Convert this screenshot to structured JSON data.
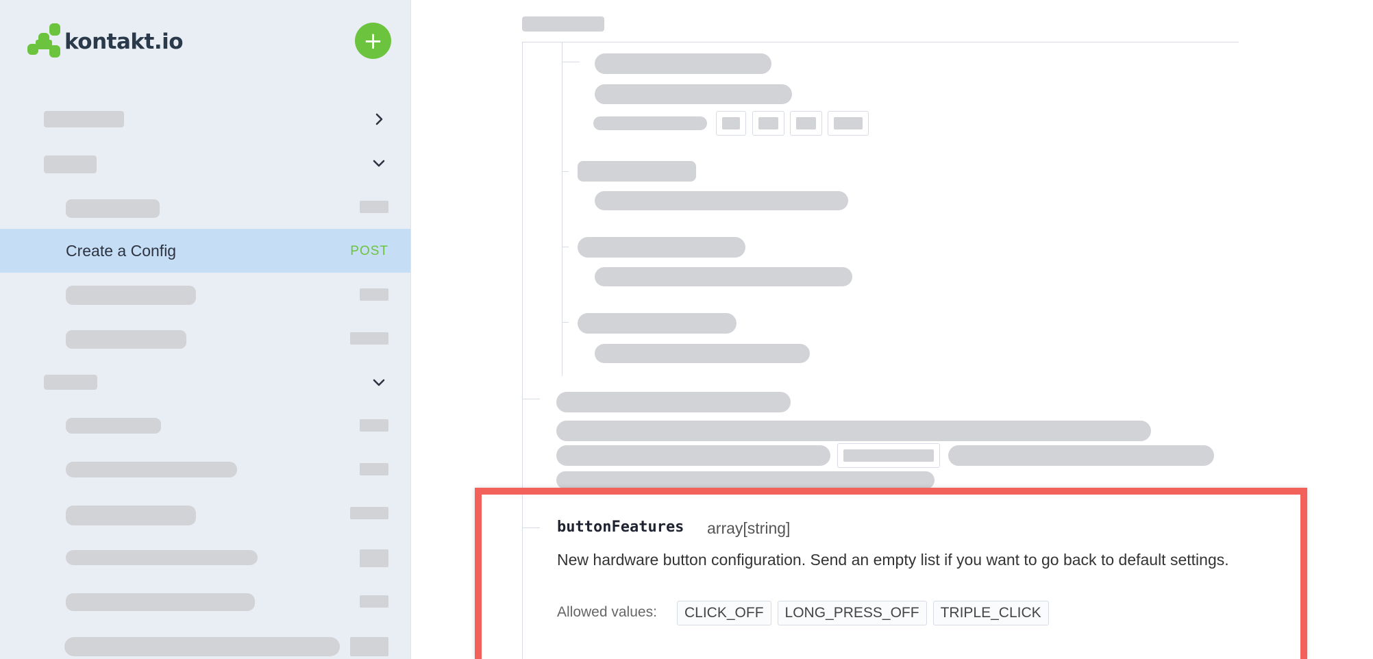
{
  "app": {
    "logo_text": "kontakt.io",
    "add_label": "+"
  },
  "sidebar": {
    "active_item": {
      "label": "Create a Config",
      "method": "POST"
    }
  },
  "field": {
    "name": "buttonFeatures",
    "type": "array[string]",
    "description": "New hardware button configuration. Send an empty list if you want to go back to default settings.",
    "allowed_label": "Allowed values:",
    "allowed_values": [
      "CLICK_OFF",
      "LONG_PRESS_OFF",
      "TRIPLE_CLICK"
    ]
  },
  "colors": {
    "brand": "#6cc33d",
    "active_bg": "#c5ddf5",
    "highlight": "#f2615a"
  }
}
